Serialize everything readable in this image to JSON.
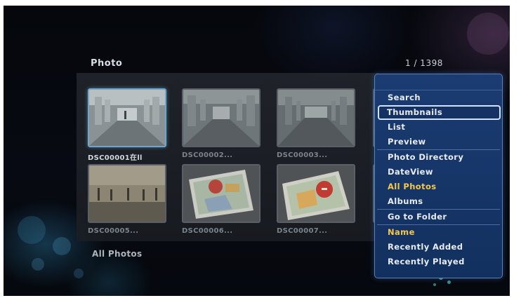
{
  "header": {
    "title": "Photo",
    "counter": "1 / 1398"
  },
  "grid": {
    "items": [
      {
        "caption": "DSC00001在ll"
      },
      {
        "caption": "DSC00002..."
      },
      {
        "caption": "DSC00003..."
      },
      {
        "caption": "DSC00005..."
      },
      {
        "caption": "DSC00006..."
      },
      {
        "caption": "DSC00007..."
      }
    ]
  },
  "footer": {
    "label": "All Photos"
  },
  "menu": {
    "items": [
      {
        "label": "Search"
      },
      {
        "label": "Thumbnails"
      },
      {
        "label": "List"
      },
      {
        "label": "Preview"
      },
      {
        "label": "Photo Directory"
      },
      {
        "label": "DateView"
      },
      {
        "label": "All Photos"
      },
      {
        "label": "Albums"
      },
      {
        "label": "Go to Folder"
      },
      {
        "label": "Name"
      },
      {
        "label": "Recently Added"
      },
      {
        "label": "Recently Played"
      }
    ]
  },
  "colors": {
    "menu_background": "#1b3c72",
    "highlight_text": "#f6c84a",
    "selected_border": "#6fa6c9"
  }
}
